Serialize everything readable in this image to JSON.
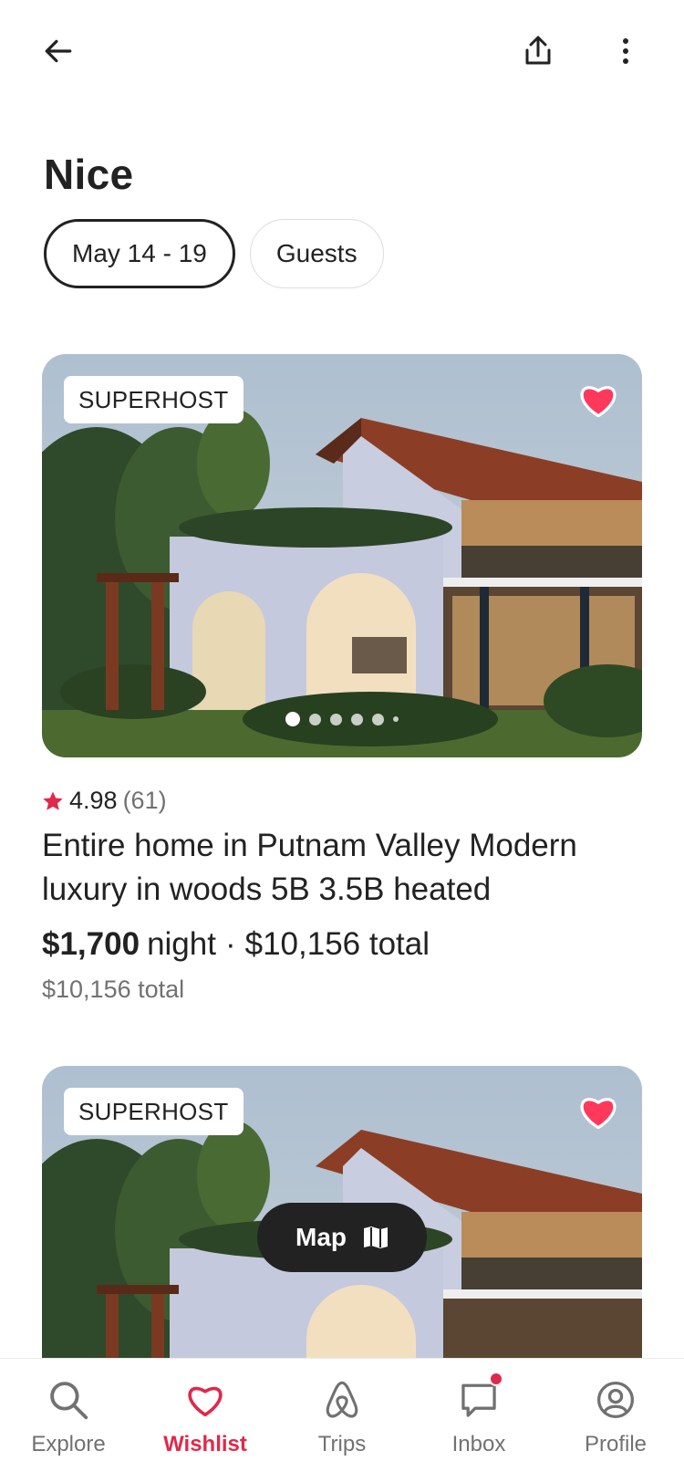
{
  "header": {
    "back_icon": "arrow-left-icon",
    "share_icon": "share-icon",
    "more_icon": "more-vertical-icon",
    "title": "Nice"
  },
  "filters": {
    "dates": "May 14 - 19",
    "guests": "Guests"
  },
  "listings": [
    {
      "badge": "SUPERHOST",
      "rating": "4.98",
      "reviews": "(61)",
      "title": "Entire home in Putnam Valley Modern luxury in woods 5B 3.5B heated",
      "price": "$1,700",
      "price_unit": "night",
      "separator": "·",
      "total": "$10,156 total",
      "total_sub": "$10,156 total",
      "photo_count": 6,
      "active_photo": 1
    },
    {
      "badge": "SUPERHOST"
    }
  ],
  "map_button": {
    "label": "Map",
    "icon": "map-icon"
  },
  "tabbar": {
    "items": [
      {
        "label": "Explore",
        "icon": "search-icon"
      },
      {
        "label": "Wishlist",
        "icon": "heart-icon"
      },
      {
        "label": "Trips",
        "icon": "airbnb-logo-icon"
      },
      {
        "label": "Inbox",
        "icon": "message-icon"
      },
      {
        "label": "Profile",
        "icon": "profile-icon"
      }
    ],
    "active": "Wishlist"
  },
  "colors": {
    "accent": "#e0294a",
    "heart": "#ff385c",
    "text": "#222222",
    "muted": "#717171"
  }
}
